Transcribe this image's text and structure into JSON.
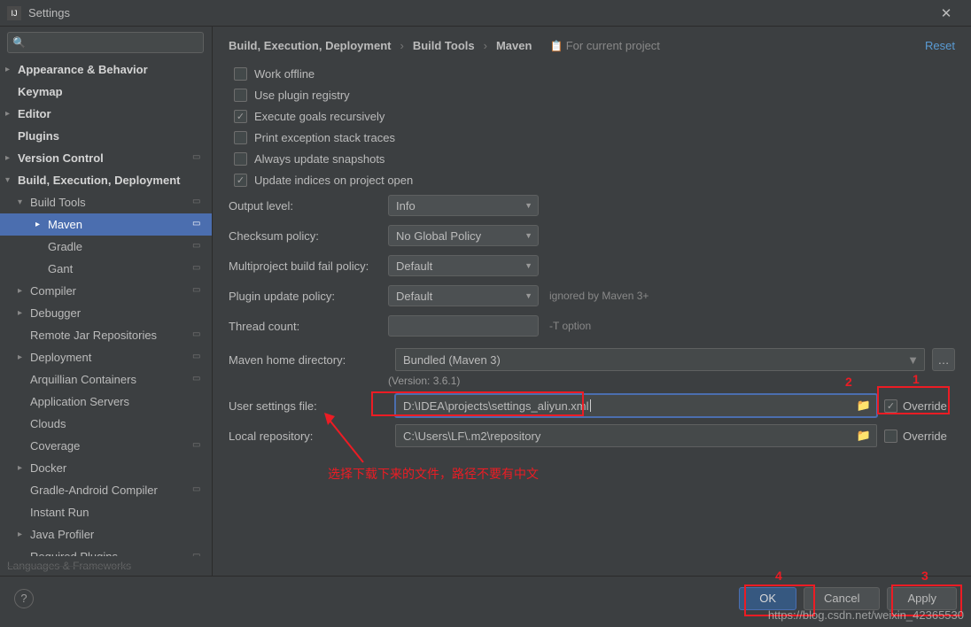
{
  "window": {
    "title": "Settings",
    "close_glyph": "✕"
  },
  "search": {
    "placeholder": ""
  },
  "sidebar": {
    "items": [
      {
        "label": "Appearance & Behavior",
        "arrow": "▸",
        "bold": true,
        "indent": 0
      },
      {
        "label": "Keymap",
        "arrow": "",
        "bold": true,
        "indent": 0
      },
      {
        "label": "Editor",
        "arrow": "▸",
        "bold": true,
        "indent": 0
      },
      {
        "label": "Plugins",
        "arrow": "",
        "bold": true,
        "indent": 0
      },
      {
        "label": "Version Control",
        "arrow": "▸",
        "bold": true,
        "proj": true,
        "indent": 0
      },
      {
        "label": "Build, Execution, Deployment",
        "arrow": "▾",
        "bold": true,
        "indent": 0
      },
      {
        "label": "Build Tools",
        "arrow": "▾",
        "bold": false,
        "proj": true,
        "indent": 1
      },
      {
        "label": "Maven",
        "arrow": "▸",
        "bold": false,
        "proj": true,
        "indent": 2,
        "selected": true
      },
      {
        "label": "Gradle",
        "arrow": "",
        "bold": false,
        "proj": true,
        "indent": 2
      },
      {
        "label": "Gant",
        "arrow": "",
        "bold": false,
        "proj": true,
        "indent": 2
      },
      {
        "label": "Compiler",
        "arrow": "▸",
        "bold": false,
        "proj": true,
        "indent": 1
      },
      {
        "label": "Debugger",
        "arrow": "▸",
        "bold": false,
        "indent": 1
      },
      {
        "label": "Remote Jar Repositories",
        "arrow": "",
        "bold": false,
        "proj": true,
        "indent": 1
      },
      {
        "label": "Deployment",
        "arrow": "▸",
        "bold": false,
        "proj": true,
        "indent": 1
      },
      {
        "label": "Arquillian Containers",
        "arrow": "",
        "bold": false,
        "proj": true,
        "indent": 1
      },
      {
        "label": "Application Servers",
        "arrow": "",
        "bold": false,
        "indent": 1
      },
      {
        "label": "Clouds",
        "arrow": "",
        "bold": false,
        "indent": 1
      },
      {
        "label": "Coverage",
        "arrow": "",
        "bold": false,
        "proj": true,
        "indent": 1
      },
      {
        "label": "Docker",
        "arrow": "▸",
        "bold": false,
        "indent": 1
      },
      {
        "label": "Gradle-Android Compiler",
        "arrow": "",
        "bold": false,
        "proj": true,
        "indent": 1
      },
      {
        "label": "Instant Run",
        "arrow": "",
        "bold": false,
        "indent": 1
      },
      {
        "label": "Java Profiler",
        "arrow": "▸",
        "bold": false,
        "indent": 1
      },
      {
        "label": "Required Plugins",
        "arrow": "",
        "bold": false,
        "proj": true,
        "indent": 1
      }
    ],
    "truncated": "Languages & Frameworks"
  },
  "breadcrumb": {
    "a": "Build, Execution, Deployment",
    "b": "Build Tools",
    "c": "Maven",
    "tag": "For current project",
    "reset": "Reset",
    "sep": "›"
  },
  "checks": [
    {
      "label": "Work offline",
      "checked": false
    },
    {
      "label": "Use plugin registry",
      "checked": false
    },
    {
      "label": "Execute goals recursively",
      "checked": true
    },
    {
      "label": "Print exception stack traces",
      "checked": false
    },
    {
      "label": "Always update snapshots",
      "checked": false
    },
    {
      "label": "Update indices on project open",
      "checked": true
    }
  ],
  "selects": {
    "output_level": {
      "label": "Output level:",
      "value": "Info"
    },
    "checksum_policy": {
      "label": "Checksum policy:",
      "value": "No Global Policy"
    },
    "multiproject": {
      "label": "Multiproject build fail policy:",
      "value": "Default"
    },
    "plugin_update": {
      "label": "Plugin update policy:",
      "value": "Default",
      "hint": "ignored by Maven 3+"
    }
  },
  "thread_count": {
    "label": "Thread count:",
    "value": "",
    "hint": "-T option"
  },
  "maven_home": {
    "label": "Maven home directory:",
    "value": "Bundled (Maven 3)"
  },
  "version": "(Version: 3.6.1)",
  "user_settings": {
    "label": "User settings file:",
    "value": "D:\\IDEA\\projects\\settings_aliyun.xml",
    "override_label": "Override",
    "override_checked": true
  },
  "local_repo": {
    "label": "Local repository:",
    "value": "C:\\Users\\LF\\.m2\\repository",
    "override_label": "Override",
    "override_checked": false
  },
  "annotation_text": "选择下载下来的文件，路径不要有中文",
  "annotation_nums": {
    "n1": "1",
    "n2": "2",
    "n3": "3",
    "n4": "4"
  },
  "footer": {
    "ok": "OK",
    "cancel": "Cancel",
    "apply": "Apply",
    "help": "?"
  },
  "watermark": "https://blog.csdn.net/weixin_42365530"
}
